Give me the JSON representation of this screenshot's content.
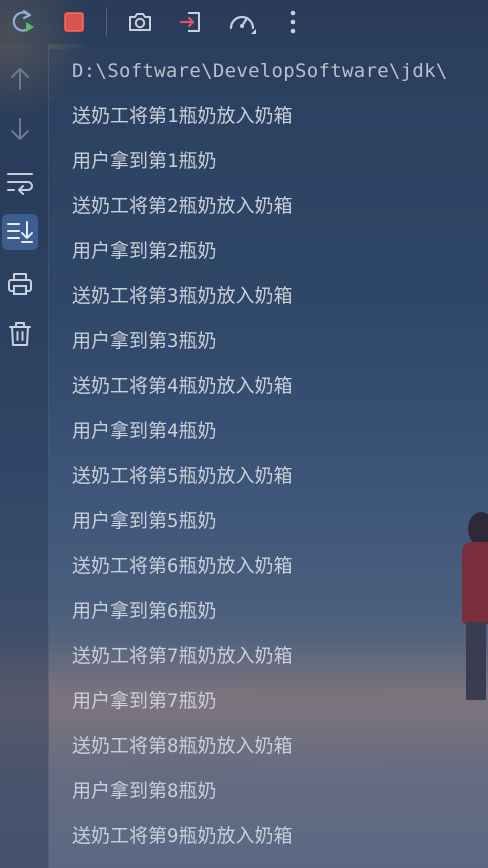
{
  "toolbar": {
    "icons": [
      "rerun-icon",
      "stop-icon",
      "screenshot-icon",
      "exit-icon",
      "profiler-icon",
      "more-icon"
    ],
    "colors": {
      "rerun": "#8fb0d8",
      "rerun_play": "#5fb85f",
      "stop": "#d9534f",
      "exit": "#e0506a",
      "icon": "#c7d0dc"
    }
  },
  "gutter": {
    "icons": [
      "arrow-up-icon",
      "arrow-down-icon",
      "soft-wrap-icon",
      "scroll-to-end-icon",
      "print-icon",
      "trash-icon"
    ],
    "active": "scroll-to-end-icon"
  },
  "console": {
    "command": "D:\\Software\\DevelopSoftware\\jdk\\",
    "lines": [
      "送奶工将第1瓶奶放入奶箱",
      "用户拿到第1瓶奶",
      "送奶工将第2瓶奶放入奶箱",
      "用户拿到第2瓶奶",
      "送奶工将第3瓶奶放入奶箱",
      "用户拿到第3瓶奶",
      "送奶工将第4瓶奶放入奶箱",
      "用户拿到第4瓶奶",
      "送奶工将第5瓶奶放入奶箱",
      "用户拿到第5瓶奶",
      "送奶工将第6瓶奶放入奶箱",
      "用户拿到第6瓶奶",
      "送奶工将第7瓶奶放入奶箱",
      "用户拿到第7瓶奶",
      "送奶工将第8瓶奶放入奶箱",
      "用户拿到第8瓶奶",
      "送奶工将第9瓶奶放入奶箱"
    ]
  }
}
